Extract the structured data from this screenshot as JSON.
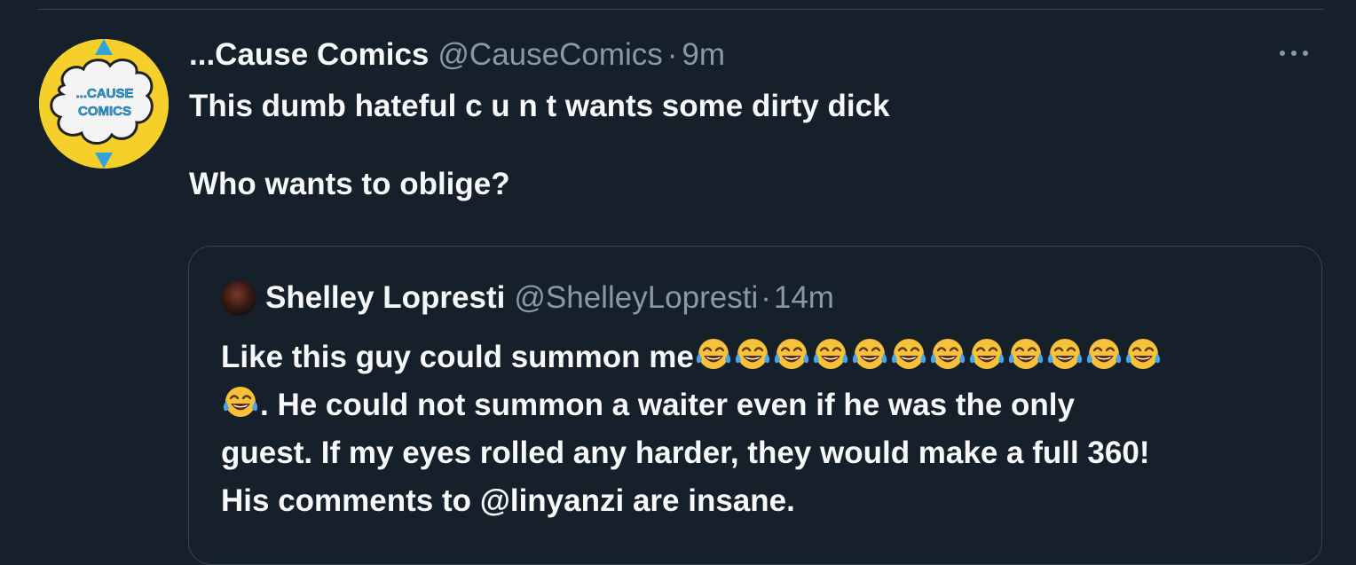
{
  "tweet": {
    "display_name": "...Cause Comics",
    "handle": "@CauseComics",
    "separator": "·",
    "time": "9m",
    "text_line1": "This dumb hateful c u n t wants some dirty dick",
    "text_line2": "",
    "text_line3": "Who wants to oblige?",
    "avatar_label_1": "...CAUSE",
    "avatar_label_2": "COMICS"
  },
  "quoted_tweet": {
    "display_name": "Shelley Lopresti",
    "handle": "@ShelleyLopresti",
    "separator": "·",
    "time": "14m",
    "line1_text": "Like this guy could summon me",
    "line1_emoji_count": 12,
    "line2_emoji_count": 1,
    "line2_text": ".  He could not summon a waiter even if he was the only",
    "line3_text": "guest. If my eyes rolled any harder, they would make a full 360!",
    "line4_text": "His comments to @linyanzi are insane.",
    "emoji_name": "face-with-tears-of-joy-emoji"
  },
  "icons": {
    "more": "more-horizontal-icon"
  },
  "colors": {
    "background": "#15202b",
    "border": "#38444d",
    "text_primary": "#f7f9f9",
    "text_secondary": "#8b98a5"
  }
}
